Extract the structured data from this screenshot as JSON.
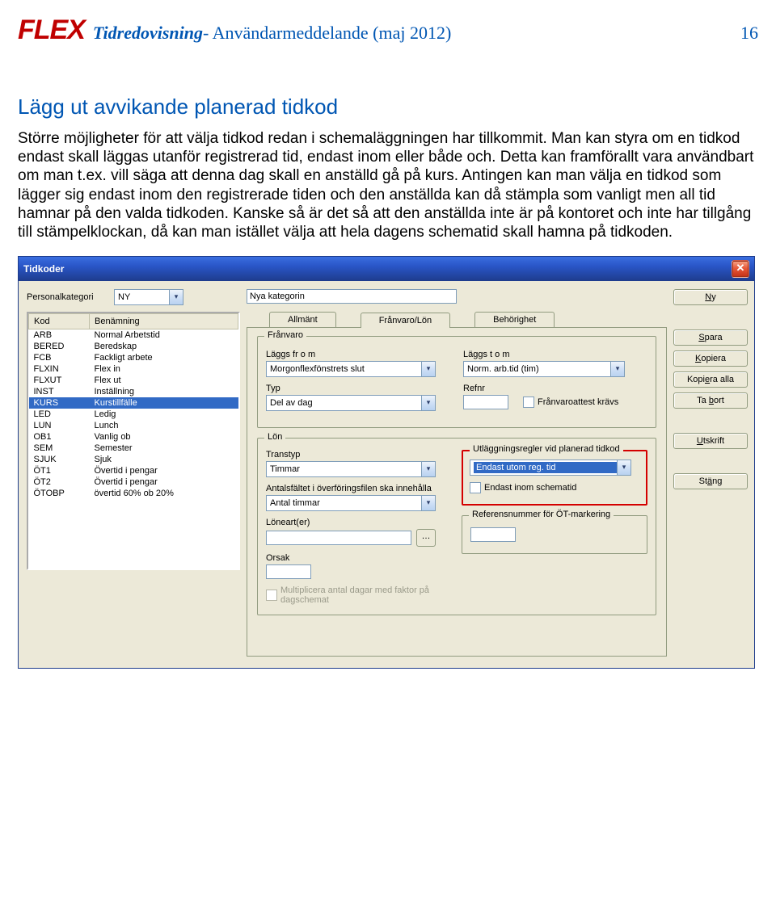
{
  "header": {
    "logo": "FLEX",
    "title_main": "Tidredovisning",
    "title_sub": " -  Användarmeddelande (maj 2012)",
    "page": "16"
  },
  "section_heading": "Lägg ut avvikande planerad tidkod",
  "body_text": "Större möjligheter för att välja tidkod redan i schemaläggningen har tillkommit. Man kan styra om en tidkod endast skall läggas utanför registrerad tid, endast inom eller både och. Detta kan framförallt vara användbart om man t.ex. vill säga att denna dag skall en anställd gå på kurs. Antingen kan man välja en tidkod som lägger sig endast inom den registrerade tiden och den anställda kan då stämpla som vanligt men all tid hamnar på den valda tidkoden. Kanske så är det så att den anställda inte är på kontoret och inte har tillgång till stämpelklockan, då kan man istället välja att hela dagens schematid skall hamna på tidkoden.",
  "dialog": {
    "title": "Tidkoder",
    "personal_label": "Personalkategori",
    "personal_value": "NY",
    "category_name": "Nya kategorin",
    "code_headers": {
      "kod": "Kod",
      "benamning": "Benämning"
    },
    "codes": [
      {
        "kod": "ARB",
        "ben": "Normal Arbetstid"
      },
      {
        "kod": "BERED",
        "ben": "Beredskap"
      },
      {
        "kod": "FCB",
        "ben": "Fackligt arbete"
      },
      {
        "kod": "FLXIN",
        "ben": "Flex in"
      },
      {
        "kod": "FLXUT",
        "ben": "Flex ut"
      },
      {
        "kod": "INST",
        "ben": "Inställning"
      },
      {
        "kod": "KURS",
        "ben": "Kurstillfälle",
        "selected": true
      },
      {
        "kod": "LED",
        "ben": "Ledig"
      },
      {
        "kod": "LUN",
        "ben": "Lunch"
      },
      {
        "kod": "OB1",
        "ben": "Vanlig ob"
      },
      {
        "kod": "SEM",
        "ben": "Semester"
      },
      {
        "kod": "SJUK",
        "ben": "Sjuk"
      },
      {
        "kod": "ÖT1",
        "ben": "Övertid i pengar"
      },
      {
        "kod": "ÖT2",
        "ben": "Övertid i pengar"
      },
      {
        "kod": "ÖTOBP",
        "ben": "övertid 60% ob 20%"
      }
    ],
    "tabs": {
      "allmant": "Allmänt",
      "franvaro": "Frånvaro/Lön",
      "behorighet": "Behörighet"
    },
    "franvaro": {
      "legend": "Frånvaro",
      "laggs_from_label": "Läggs fr o m",
      "laggs_from_value": "Morgonflexfönstrets slut",
      "laggs_tom_label": "Läggs t o m",
      "laggs_tom_value": "Norm. arb.tid (tim)",
      "typ_label": "Typ",
      "typ_value": "Del av dag",
      "refnr_label": "Refnr",
      "refnr_value": "",
      "attest_label": "Frånvaroattest krävs"
    },
    "lon": {
      "legend": "Lön",
      "transtyp_label": "Transtyp",
      "transtyp_value": "Timmar",
      "antalsfalt_label": "Antalsfältet i överföringsfilen ska innehålla",
      "antalsfalt_value": "Antal timmar",
      "loneart_label": "Löneart(er)",
      "orsak_label": "Orsak",
      "multiplicera_label": "Multiplicera antal dagar med faktor på dagschemat"
    },
    "utlaggning": {
      "legend": "Utläggningsregler vid planerad tidkod",
      "value": "Endast utom reg. tid",
      "schematid_label": "Endast inom schematid"
    },
    "refnr_ot": {
      "legend": "Referensnummer för ÖT-markering"
    },
    "buttons": {
      "ny": "Ny",
      "spara": "Spara",
      "kopiera": "Kopiera",
      "kopiera_alla": "Kopiera alla",
      "ta_bort": "Ta bort",
      "utskrift": "Utskrift",
      "stang": "Stäng"
    }
  }
}
